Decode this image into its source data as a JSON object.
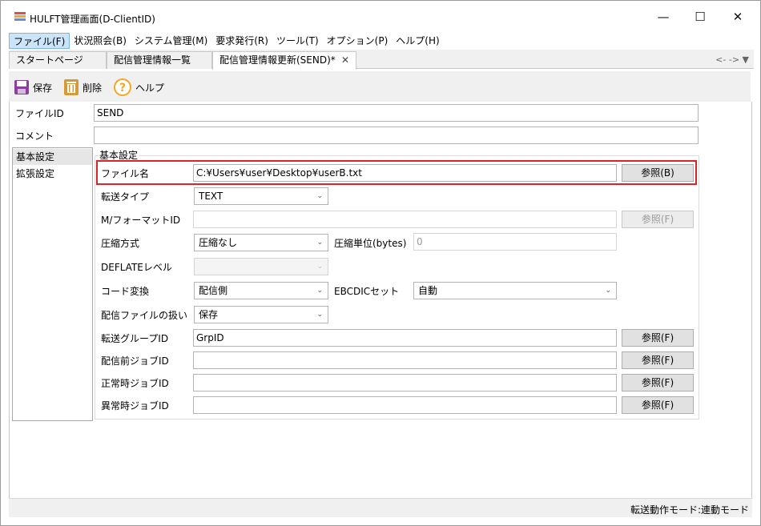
{
  "window": {
    "title": "HULFT管理画面(D-ClientID)",
    "minimize": "—",
    "maximize": "☐",
    "close": "✕"
  },
  "menu": {
    "items": [
      {
        "label": "ファイル(F)"
      },
      {
        "label": "状況照会(B)"
      },
      {
        "label": "システム管理(M)"
      },
      {
        "label": "要求発行(R)"
      },
      {
        "label": "ツール(T)"
      },
      {
        "label": "オプション(P)"
      },
      {
        "label": "ヘルプ(H)"
      }
    ]
  },
  "tabs": {
    "items": [
      {
        "label": "スタートページ"
      },
      {
        "label": "配信管理情報一覧"
      },
      {
        "label": "配信管理情報更新(SEND)*"
      }
    ],
    "close": "✕",
    "nav": "<- -> ▼"
  },
  "toolbar": {
    "save": "保存",
    "delete": "削除",
    "help": "ヘルプ"
  },
  "header_fields": {
    "file_id_label": "ファイルID",
    "file_id_value": "SEND",
    "comment_label": "コメント",
    "comment_value": ""
  },
  "sidebar": {
    "items": [
      {
        "label": "基本設定"
      },
      {
        "label": "拡張設定"
      }
    ]
  },
  "basic": {
    "group_title": "基本設定",
    "file_name_label": "ファイル名",
    "file_name_value": "C:¥Users¥user¥Desktop¥userB.txt",
    "browse_b": "参照(B)",
    "transfer_type_label": "転送タイプ",
    "transfer_type_value": "TEXT",
    "format_id_label": "M/フォーマットID",
    "format_id_value": "",
    "browse_f": "参照(F)",
    "compression_label": "圧縮方式",
    "compression_value": "圧縮なし",
    "compression_unit_label": "圧縮単位(bytes)",
    "compression_unit_value": "0",
    "deflate_label": "DEFLATEレベル",
    "deflate_value": "",
    "code_conv_label": "コード変換",
    "code_conv_value": "配信側",
    "ebcdic_label": "EBCDICセット",
    "ebcdic_value": "自動",
    "file_handling_label": "配信ファイルの扱い",
    "file_handling_value": "保存",
    "group_id_label": "転送グループID",
    "group_id_value": "GrpID",
    "pre_job_label": "配信前ジョブID",
    "pre_job_value": "",
    "normal_job_label": "正常時ジョブID",
    "normal_job_value": "",
    "error_job_label": "異常時ジョブID",
    "error_job_value": ""
  },
  "status": {
    "text": "転送動作モード:連動モード"
  },
  "colors": {
    "highlight": "#d9252a",
    "menu_active": "#cce4f7",
    "help_icon": "#f5a623",
    "save_icon": "#8a3f9a"
  }
}
